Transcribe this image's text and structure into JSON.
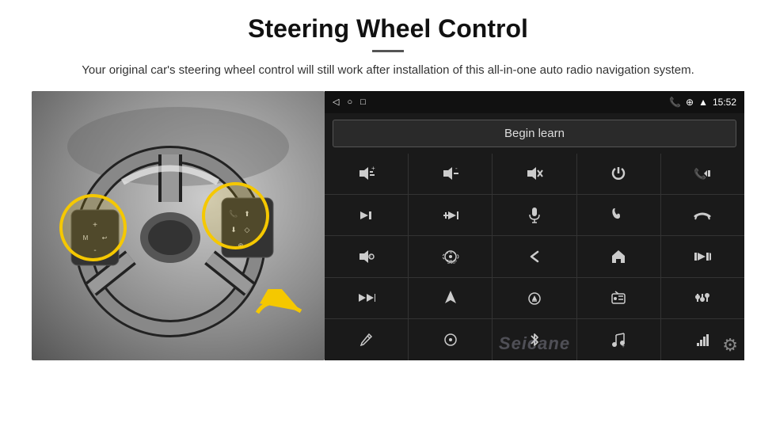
{
  "header": {
    "title": "Steering Wheel Control",
    "divider": true,
    "subtitle": "Your original car's steering wheel control will still work after installation of this all-in-one auto radio navigation system."
  },
  "android_panel": {
    "status_bar": {
      "nav_icons": [
        "◁",
        "○",
        "□"
      ],
      "right_icons": [
        "📞",
        "⊕",
        "▲",
        "15:52"
      ]
    },
    "begin_learn_label": "Begin learn",
    "controls": [
      {
        "icon": "🔊+",
        "symbol": "vol_up"
      },
      {
        "icon": "🔊-",
        "symbol": "vol_down"
      },
      {
        "icon": "🔇",
        "symbol": "mute"
      },
      {
        "icon": "⏻",
        "symbol": "power"
      },
      {
        "icon": "📞⏮",
        "symbol": "phone_prev"
      },
      {
        "icon": "⏭",
        "symbol": "next_track"
      },
      {
        "icon": "✖⏭",
        "symbol": "skip"
      },
      {
        "icon": "🎤",
        "symbol": "mic"
      },
      {
        "icon": "📞",
        "symbol": "phone"
      },
      {
        "icon": "↩",
        "symbol": "hang_up"
      },
      {
        "icon": "📢",
        "symbol": "horn"
      },
      {
        "icon": "360",
        "symbol": "camera_360"
      },
      {
        "icon": "↩",
        "symbol": "back"
      },
      {
        "icon": "🏠",
        "symbol": "home"
      },
      {
        "icon": "⏮⏮",
        "symbol": "prev_prev"
      },
      {
        "icon": "⏭⏭",
        "symbol": "ff"
      },
      {
        "icon": "▲",
        "symbol": "nav"
      },
      {
        "icon": "⏏",
        "symbol": "eject"
      },
      {
        "icon": "📻",
        "symbol": "radio"
      },
      {
        "icon": "≡",
        "symbol": "eq"
      },
      {
        "icon": "✏",
        "symbol": "pen"
      },
      {
        "icon": "⊙",
        "symbol": "circle"
      },
      {
        "icon": "✱",
        "symbol": "bluetooth"
      },
      {
        "icon": "♪",
        "symbol": "music"
      },
      {
        "icon": "|||",
        "symbol": "bars"
      }
    ],
    "seicane_watermark": "Seicane",
    "gear_icon": "⚙"
  }
}
